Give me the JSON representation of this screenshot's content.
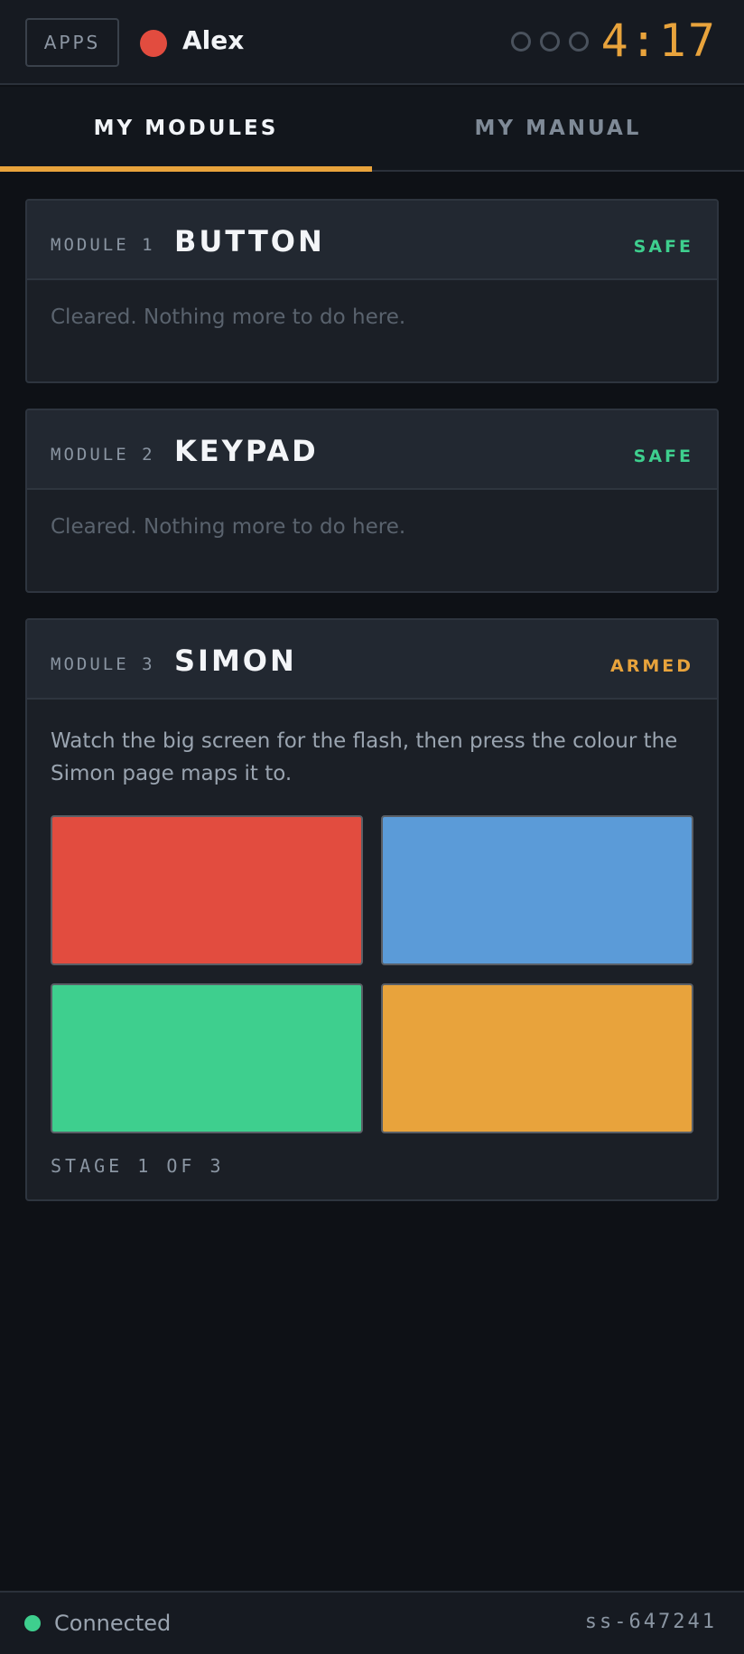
{
  "header": {
    "apps_label": "APPS",
    "player_name": "Alex",
    "player_color": "#e24c3f",
    "strikes_total": 3,
    "strikes_used": 0,
    "timer": "4:17"
  },
  "tabs": [
    {
      "label": "MY MODULES",
      "active": true
    },
    {
      "label": "MY MANUAL",
      "active": false
    }
  ],
  "modules": [
    {
      "number": "MODULE 1",
      "name": "BUTTON",
      "status": "SAFE",
      "status_color": "#3ecf8e",
      "body": "Cleared. Nothing more to do here."
    },
    {
      "number": "MODULE 2",
      "name": "KEYPAD",
      "status": "SAFE",
      "status_color": "#3ecf8e",
      "body": "Cleared. Nothing more to do here."
    },
    {
      "number": "MODULE 3",
      "name": "SIMON",
      "status": "ARMED",
      "status_color": "#e8a33c",
      "instructions": "Watch the big screen for the flash, then press the colour the Simon page maps it to.",
      "buttons": [
        {
          "color_name": "red",
          "color": "#e24c3f"
        },
        {
          "color_name": "blue",
          "color": "#5b9bd8"
        },
        {
          "color_name": "green",
          "color": "#3ecf8e"
        },
        {
          "color_name": "yellow",
          "color": "#e8a33c"
        }
      ],
      "stage": "STAGE 1 OF 3"
    }
  ],
  "footer": {
    "connection": "Connected",
    "connection_color": "#3ecf8e",
    "session_id": "ss-647241"
  }
}
